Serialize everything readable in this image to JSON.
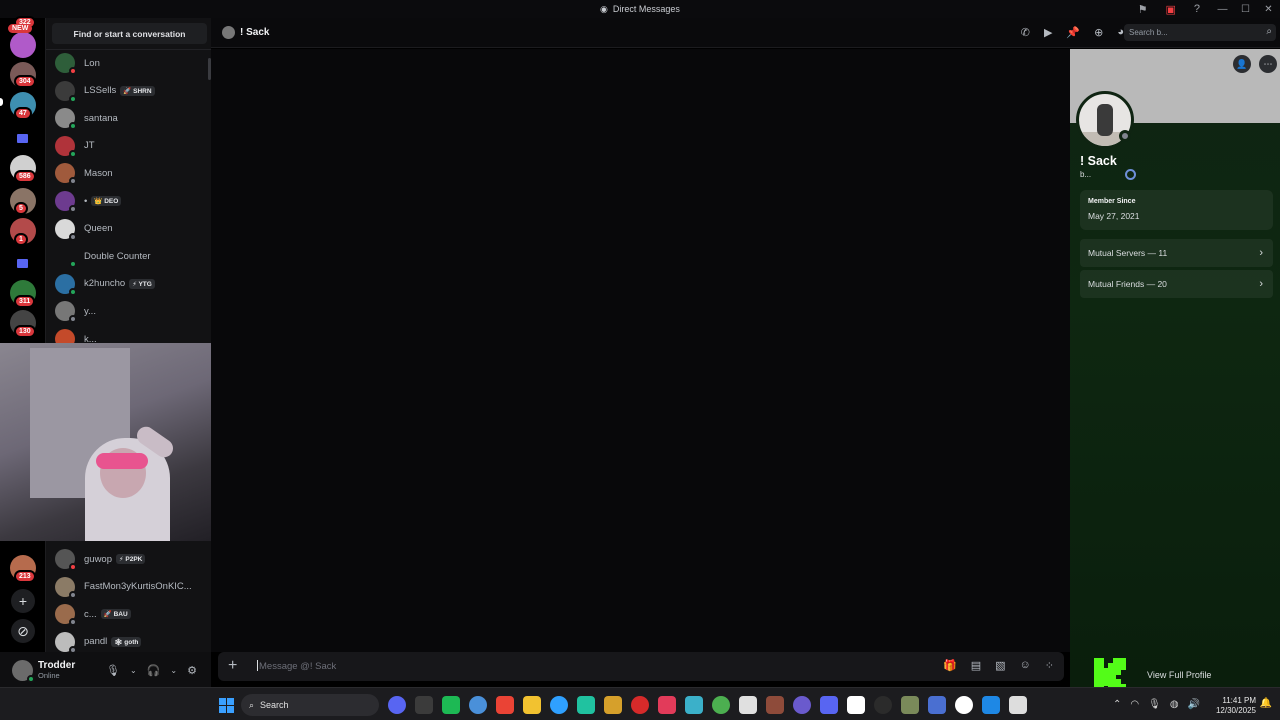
{
  "window": {
    "title": "Direct Messages"
  },
  "rail": {
    "new_label": "NEW",
    "top_count": "322",
    "badges": [
      "304",
      "47",
      "586",
      "5",
      "1",
      "311",
      "130",
      "213"
    ]
  },
  "dm_list": {
    "find_label": "Find or start a conversation",
    "items": [
      {
        "name": "Lon",
        "tag": "",
        "status": "dnd",
        "color": "#2e5e3a"
      },
      {
        "name": "LSSells",
        "tag": "🚀 SHRN",
        "status": "on",
        "color": "#3b3b3b"
      },
      {
        "name": "santana",
        "tag": "",
        "status": "on",
        "color": "#8a8a8a"
      },
      {
        "name": "JT",
        "tag": "",
        "status": "on",
        "color": "#b0333a"
      },
      {
        "name": "Mason",
        "tag": "",
        "status": "off",
        "color": "#a05a3c"
      },
      {
        "name": "•",
        "tag": "👑 DEO",
        "status": "off",
        "color": "#6d3b8f"
      },
      {
        "name": "Queen",
        "tag": "",
        "status": "off",
        "color": "#d9d9d9"
      },
      {
        "name": "Double Counter",
        "tag": "",
        "status": "on",
        "color": "#121214"
      },
      {
        "name": "k2huncho",
        "tag": "⚡ YTG",
        "status": "on",
        "color": "#2b6fa3"
      },
      {
        "name": "y...",
        "tag": "",
        "status": "off",
        "color": "#777777"
      },
      {
        "name": "k...",
        "tag": "",
        "status": "off",
        "color": "#c44a2a"
      }
    ],
    "lower_items": [
      {
        "name": "guwop",
        "tag": "⚡ P2PK",
        "status": "dnd",
        "color": "#555555"
      },
      {
        "name": "FastMon3yKurtisOnKIC...",
        "tag": "",
        "status": "off",
        "color": "#8b7b66"
      },
      {
        "name": "c...",
        "tag": "🚀 BAU",
        "status": "off",
        "color": "#9a6b4c"
      },
      {
        "name": "pandl",
        "tag": "🕸 goth",
        "status": "off",
        "color": "#bcbcbc"
      }
    ]
  },
  "user_panel": {
    "name": "Trodder",
    "status": "Online"
  },
  "chat": {
    "recipient": "! Sack",
    "search_placeholder": "Search b...",
    "composer_placeholder": "Message @! Sack"
  },
  "profile": {
    "name": "! Sack",
    "username": "b...",
    "member_since_label": "Member Since",
    "member_since_value": "May 27, 2021",
    "mutual_servers": "Mutual Servers — 11",
    "mutual_friends": "Mutual Friends — 20",
    "view_full_profile": "View Full Profile"
  },
  "taskbar": {
    "search_label": "Search",
    "time": "11:41 PM",
    "date": "12/30/2025",
    "app_colors": [
      "#5865f2",
      "#3b3b3b",
      "#1db954",
      "#4a90d9",
      "#ea4335",
      "#f2c230",
      "#2fa0ff",
      "#20c2a0",
      "#d6a02b",
      "#d62a2a",
      "#e23b5a",
      "#3bb0c9",
      "#4caf50",
      "#e0e0e0",
      "#8e4b3a",
      "#6a5acd",
      "#5865f2",
      "#ffffff",
      "#2b2b2b",
      "#7a8a5a",
      "#4a6fd1",
      "#ffffff",
      "#1e88e5",
      "#dddddd"
    ]
  }
}
